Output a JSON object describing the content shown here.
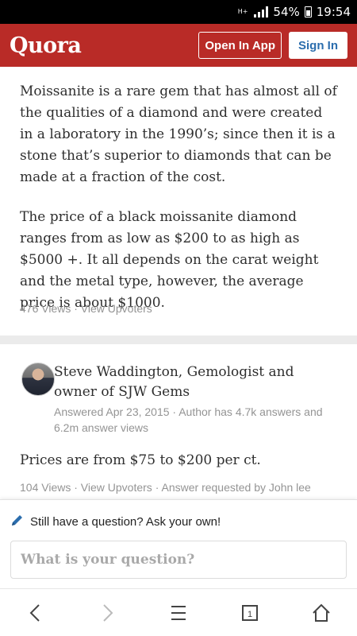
{
  "status_bar": {
    "network": "H+",
    "battery": "54%",
    "time": "19:54"
  },
  "header": {
    "logo": "Quora",
    "open_in_app": "Open In App",
    "sign_in": "Sign In"
  },
  "answer1": {
    "paragraph1": "Moissanite is a rare gem that has almost all of the qualities of a diamond and were created in a laboratory in the 1990’s; since then it is a stone that’s superior to diamonds that can be made at a fraction of the cost.",
    "paragraph2": "The price of a black moissanite diamond ranges from as low as $200 to as high as $5000 +. It all depends on the carat weight and the metal type, however, the average price is about $1000.",
    "views": "476 Views",
    "sep": "·",
    "upvoters": "View Upvoters"
  },
  "answer2": {
    "author": "Steve Waddington, Gemologist and owner of SJW Gems",
    "meta": "Answered Apr 23, 2015 · Author has 4.7k answers and 6.2m answer views",
    "text": "Prices are from $75 to $200 per ct.",
    "views": "104 Views",
    "sep": "·",
    "upvoters": "View Upvoters",
    "requested": "Answer requested by John lee"
  },
  "ask": {
    "prompt": "Still have a question? Ask your own!",
    "placeholder": "What is your question?"
  },
  "colors": {
    "brand": "#b92b27",
    "link_blue": "#2b6dad",
    "meta_gray": "#949494"
  },
  "icons": {
    "ask": "pencil-icon",
    "nav": [
      "back-icon",
      "forward-icon",
      "menu-icon",
      "tabs-icon",
      "home-icon"
    ],
    "tab_count": "1"
  }
}
